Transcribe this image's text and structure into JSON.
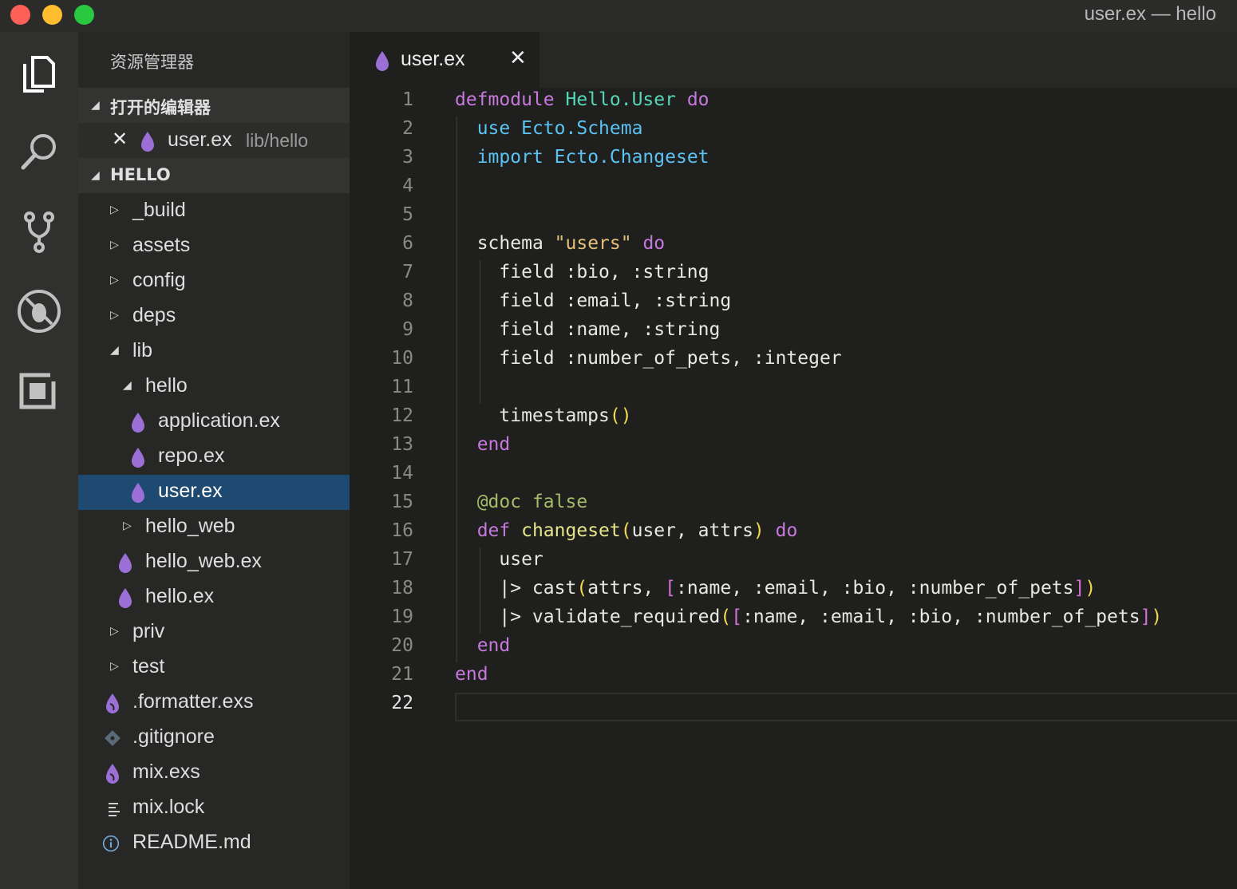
{
  "window": {
    "title": "user.ex — hello"
  },
  "activity_bar": {
    "items": [
      "explorer-icon",
      "search-icon",
      "source-control-icon",
      "debug-icon",
      "extensions-icon"
    ]
  },
  "sidebar": {
    "title": "资源管理器",
    "open_editors_header": "打开的编辑器",
    "open_editor": {
      "name": "user.ex",
      "path": "lib/hello"
    },
    "project_header": "HELLO",
    "tree": [
      {
        "label": "_build"
      },
      {
        "label": "assets"
      },
      {
        "label": "config"
      },
      {
        "label": "deps"
      },
      {
        "label": "lib"
      },
      {
        "label": "hello"
      },
      {
        "label": "application.ex"
      },
      {
        "label": "repo.ex"
      },
      {
        "label": "user.ex"
      },
      {
        "label": "hello_web"
      },
      {
        "label": "hello_web.ex"
      },
      {
        "label": "hello.ex"
      },
      {
        "label": "priv"
      },
      {
        "label": "test"
      },
      {
        "label": ".formatter.exs"
      },
      {
        "label": ".gitignore"
      },
      {
        "label": "mix.exs"
      },
      {
        "label": "mix.lock"
      },
      {
        "label": "README.md"
      }
    ]
  },
  "editor": {
    "tab": {
      "label": "user.ex",
      "close": "✕"
    },
    "current_line": 22,
    "line_numbers": [
      "1",
      "2",
      "3",
      "4",
      "5",
      "6",
      "7",
      "8",
      "9",
      "10",
      "11",
      "12",
      "13",
      "14",
      "15",
      "16",
      "17",
      "18",
      "19",
      "20",
      "21",
      "22"
    ],
    "code": {
      "l1": [
        "defmodule",
        "Hello.User",
        "do"
      ],
      "l2": [
        "use",
        "Ecto.Schema"
      ],
      "l3": [
        "import",
        "Ecto.Changeset"
      ],
      "l6": [
        "schema",
        "\"users\"",
        "do"
      ],
      "l7": "field :bio, :string",
      "l8": "field :email, :string",
      "l9": "field :name, :string",
      "l10": "field :number_of_pets, :integer",
      "l12": [
        "timestamps",
        "()"
      ],
      "l13": "end",
      "l15": [
        "@doc",
        "false"
      ],
      "l16": [
        "def",
        "changeset",
        "(",
        "user, attrs",
        ")",
        "do"
      ],
      "l17": "user",
      "l18": [
        "|> cast",
        "(",
        "attrs, ",
        "[",
        ":name, :email, :bio, :number_of_pets",
        "]",
        ")"
      ],
      "l19": [
        "|> validate_required",
        "(",
        "[",
        ":name, :email, :bio, :number_of_pets",
        "]",
        ")"
      ],
      "l20": "end",
      "l21": "end"
    }
  }
}
